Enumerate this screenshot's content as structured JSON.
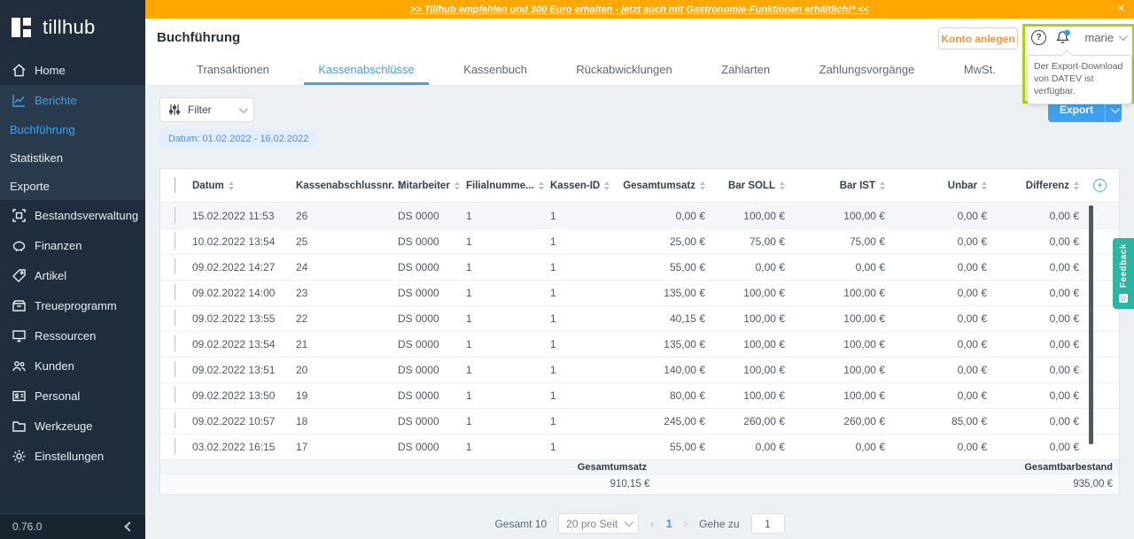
{
  "logo": {
    "text": "tillhub"
  },
  "banner": {
    "text": ">> Tillhub empfehlen und 300 Euro erhalten - jetzt auch mit Gastronomie-Funktionen erhältlich!* <<",
    "close": "✕"
  },
  "sidebar": {
    "items": [
      {
        "label": "Home",
        "icon": "home"
      },
      {
        "label": "Berichte",
        "icon": "chart",
        "active": true,
        "group": true
      },
      {
        "label": "Buchführung",
        "sub": true,
        "active": true,
        "group": true
      },
      {
        "label": "Statistiken",
        "sub": true,
        "group": true
      },
      {
        "label": "Exporte",
        "sub": true,
        "group": true
      },
      {
        "label": "Bestandsverwaltung",
        "icon": "inventory"
      },
      {
        "label": "Finanzen",
        "icon": "finance"
      },
      {
        "label": "Artikel",
        "icon": "tag"
      },
      {
        "label": "Treueprogramm",
        "icon": "loyalty"
      },
      {
        "label": "Ressourcen",
        "icon": "monitor"
      },
      {
        "label": "Kunden",
        "icon": "people"
      },
      {
        "label": "Personal",
        "icon": "idcard"
      },
      {
        "label": "Werkzeuge",
        "icon": "folder"
      },
      {
        "label": "Einstellungen",
        "icon": "gear"
      }
    ],
    "version": "0.76.0"
  },
  "header": {
    "title": "Buchführung",
    "konto_button": "Konto anlegen",
    "help_icon": "?",
    "user": "marie",
    "tooltip": "Der Export-Download von DATEV ist verfügbar."
  },
  "tabs": [
    {
      "label": "Transaktionen"
    },
    {
      "label": "Kassenabschlüsse",
      "active": true
    },
    {
      "label": "Kassenbuch"
    },
    {
      "label": "Rückabwicklungen"
    },
    {
      "label": "Zahlarten"
    },
    {
      "label": "Zahlungsvorgänge"
    },
    {
      "label": "MwSt."
    }
  ],
  "toolbar": {
    "filter_label": "Filter",
    "date_chip": "Datum: 01.02.2022 - 16.02.2022",
    "export_label": "Export"
  },
  "table": {
    "columns": [
      "Datum",
      "Kassenabschlussnr.",
      "Mitarbeiter",
      "Filialnumme...",
      "Kassen-ID",
      "Gesamtumsatz",
      "Bar SOLL",
      "Bar IST",
      "Unbar",
      "Differenz"
    ],
    "rows": [
      [
        "15.02.2022 11:53",
        "26",
        "DS 0000",
        "1",
        "1",
        "0,00 €",
        "100,00 €",
        "100,00 €",
        "0,00 €",
        "0,00 €"
      ],
      [
        "10.02.2022 13:54",
        "25",
        "DS 0000",
        "1",
        "1",
        "25,00 €",
        "75,00 €",
        "75,00 €",
        "0,00 €",
        "0,00 €"
      ],
      [
        "09.02.2022 14:27",
        "24",
        "DS 0000",
        "1",
        "1",
        "55,00 €",
        "0,00 €",
        "0,00 €",
        "0,00 €",
        "0,00 €"
      ],
      [
        "09.02.2022 14:00",
        "23",
        "DS 0000",
        "1",
        "1",
        "135,00 €",
        "100,00 €",
        "100,00 €",
        "0,00 €",
        "0,00 €"
      ],
      [
        "09.02.2022 13:55",
        "22",
        "DS 0000",
        "1",
        "1",
        "40,15 €",
        "100,00 €",
        "100,00 €",
        "0,00 €",
        "0,00 €"
      ],
      [
        "09.02.2022 13:54",
        "21",
        "DS 0000",
        "1",
        "1",
        "135,00 €",
        "100,00 €",
        "100,00 €",
        "0,00 €",
        "0,00 €"
      ],
      [
        "09.02.2022 13:51",
        "20",
        "DS 0000",
        "1",
        "1",
        "140,00 €",
        "100,00 €",
        "100,00 €",
        "0,00 €",
        "0,00 €"
      ],
      [
        "09.02.2022 13:50",
        "19",
        "DS 0000",
        "1",
        "1",
        "80,00 €",
        "100,00 €",
        "100,00 €",
        "0,00 €",
        "0,00 €"
      ],
      [
        "09.02.2022 10:57",
        "18",
        "DS 0000",
        "1",
        "1",
        "245,00 €",
        "260,00 €",
        "260,00 €",
        "85,00 €",
        "0,00 €"
      ],
      [
        "03.02.2022 16:15",
        "17",
        "DS 0000",
        "1",
        "1",
        "55,00 €",
        "0,00 €",
        "0,00 €",
        "0,00 €",
        "0,00 €"
      ]
    ],
    "totals": {
      "umsatz_label": "Gesamtumsatz",
      "umsatz_value": "910,15 €",
      "bar_label": "Gesamtbarbestand",
      "bar_value": "935,00 €"
    }
  },
  "pagination": {
    "total": "Gesamt 10",
    "per_page": "20 pro Seit",
    "prev": "‹",
    "page": "1",
    "next": "›",
    "goto_label": "Gehe zu",
    "goto_value": "1"
  },
  "feedback": {
    "label": "Feedback"
  },
  "colors": {
    "accent_blue": "#42a0e8",
    "banner_orange": "#ffa800",
    "sidebar_bg": "#1f2d3d",
    "konto_orange": "#f5993d",
    "feedback_teal": "#2bb6a4",
    "annotation_green": "#a9d414"
  }
}
